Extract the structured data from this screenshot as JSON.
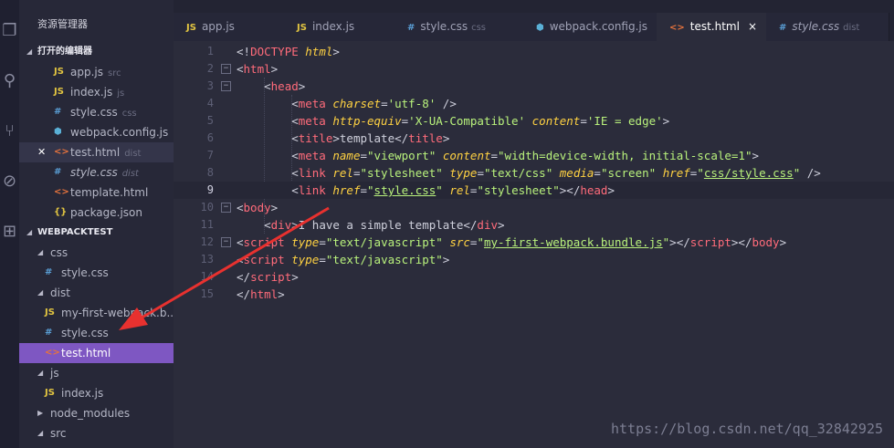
{
  "activity_bar": [
    {
      "name": "explorer-icon",
      "glyph": "❐"
    },
    {
      "name": "search-icon",
      "glyph": "⚲"
    },
    {
      "name": "source-control-icon",
      "glyph": "⑂"
    },
    {
      "name": "debug-icon",
      "glyph": "⊘"
    },
    {
      "name": "extensions-icon",
      "glyph": "⊞"
    }
  ],
  "sidebar": {
    "title": "资源管理器",
    "open_editors_label": "打开的编辑器",
    "open_editors": [
      {
        "icon": "JS",
        "icon_class": "i-js",
        "label": "app.js",
        "desc": "src"
      },
      {
        "icon": "JS",
        "icon_class": "i-js",
        "label": "index.js",
        "desc": "js"
      },
      {
        "icon": "#",
        "icon_class": "i-css",
        "label": "style.css",
        "desc": "css"
      },
      {
        "icon": "⬢",
        "icon_class": "i-cfg",
        "label": "webpack.config.js",
        "desc": ""
      },
      {
        "icon": "<>",
        "icon_class": "i-html",
        "label": "test.html",
        "desc": "dist",
        "active": true
      },
      {
        "icon": "#",
        "icon_class": "i-css",
        "label": "style.css",
        "desc": "dist",
        "italic": true
      },
      {
        "icon": "<>",
        "icon_class": "i-html",
        "label": "template.html",
        "desc": ""
      },
      {
        "icon": "{}",
        "icon_class": "i-json",
        "label": "package.json",
        "desc": ""
      }
    ],
    "project_label": "WEBPACKTEST",
    "tree": [
      {
        "type": "folder",
        "label": "css",
        "depth": 1,
        "open": true
      },
      {
        "type": "file",
        "icon": "#",
        "icon_class": "i-css",
        "label": "style.css",
        "depth": 2
      },
      {
        "type": "folder",
        "label": "dist",
        "depth": 1,
        "open": true
      },
      {
        "type": "file",
        "icon": "JS",
        "icon_class": "i-js",
        "label": "my-first-webpack.b...",
        "depth": 2
      },
      {
        "type": "file",
        "icon": "#",
        "icon_class": "i-css",
        "label": "style.css",
        "depth": 2
      },
      {
        "type": "file",
        "icon": "<>",
        "icon_class": "i-html",
        "label": "test.html",
        "depth": 2,
        "selected": true
      },
      {
        "type": "folder",
        "label": "js",
        "depth": 1,
        "open": true
      },
      {
        "type": "file",
        "icon": "JS",
        "icon_class": "i-js",
        "label": "index.js",
        "depth": 2
      },
      {
        "type": "folder",
        "label": "node_modules",
        "depth": 1,
        "open": false
      },
      {
        "type": "folder",
        "label": "src",
        "depth": 1,
        "open": true
      }
    ]
  },
  "tabs": [
    {
      "icon": "JS",
      "icon_class": "i-js",
      "label": "app.js",
      "desc": ""
    },
    {
      "icon": "JS",
      "icon_class": "i-js",
      "label": "index.js",
      "desc": ""
    },
    {
      "icon": "#",
      "icon_class": "i-css",
      "label": "style.css",
      "desc": "css"
    },
    {
      "icon": "⬢",
      "icon_class": "i-cfg",
      "label": "webpack.config.js",
      "desc": ""
    },
    {
      "icon": "<>",
      "icon_class": "i-html",
      "label": "test.html",
      "desc": "",
      "active": true,
      "close": "×"
    },
    {
      "icon": "#",
      "icon_class": "i-css",
      "label": "style.css",
      "desc": "dist",
      "italic": true
    }
  ],
  "editor": {
    "current_line": 9,
    "lines": [
      [
        [
          "p",
          "<!"
        ],
        [
          "t",
          "DOCTYPE"
        ],
        [
          "p",
          " "
        ],
        [
          "a",
          "html"
        ],
        [
          "p",
          ">"
        ]
      ],
      [
        [
          "p",
          "<"
        ],
        [
          "t",
          "html"
        ],
        [
          "p",
          ">"
        ]
      ],
      [
        [
          "p",
          "    <"
        ],
        [
          "t",
          "head"
        ],
        [
          "p",
          ">"
        ]
      ],
      [
        [
          "p",
          "        <"
        ],
        [
          "t",
          "meta"
        ],
        [
          "p",
          " "
        ],
        [
          "a",
          "charset"
        ],
        [
          "p",
          "="
        ],
        [
          "s",
          "'utf-8'"
        ],
        [
          "p",
          " />"
        ]
      ],
      [
        [
          "p",
          "        <"
        ],
        [
          "t",
          "meta"
        ],
        [
          "p",
          " "
        ],
        [
          "a",
          "http-equiv"
        ],
        [
          "p",
          "="
        ],
        [
          "s",
          "'X-UA-Compatible'"
        ],
        [
          "p",
          " "
        ],
        [
          "a",
          "content"
        ],
        [
          "p",
          "="
        ],
        [
          "s",
          "'IE = edge'"
        ],
        [
          "p",
          ">"
        ]
      ],
      [
        [
          "p",
          "        <"
        ],
        [
          "t",
          "title"
        ],
        [
          "p",
          ">template</"
        ],
        [
          "t",
          "title"
        ],
        [
          "p",
          ">"
        ]
      ],
      [
        [
          "p",
          "        <"
        ],
        [
          "t",
          "meta"
        ],
        [
          "p",
          " "
        ],
        [
          "a",
          "name"
        ],
        [
          "p",
          "="
        ],
        [
          "s",
          "\"viewport\""
        ],
        [
          "p",
          " "
        ],
        [
          "a",
          "content"
        ],
        [
          "p",
          "="
        ],
        [
          "s",
          "\"width=device-width, initial-scale=1\""
        ],
        [
          "p",
          ">"
        ]
      ],
      [
        [
          "p",
          "        <"
        ],
        [
          "t",
          "link"
        ],
        [
          "p",
          " "
        ],
        [
          "a",
          "rel"
        ],
        [
          "p",
          "="
        ],
        [
          "s",
          "\"stylesheet\""
        ],
        [
          "p",
          " "
        ],
        [
          "a",
          "type"
        ],
        [
          "p",
          "="
        ],
        [
          "s",
          "\"text/css\""
        ],
        [
          "p",
          " "
        ],
        [
          "a",
          "media"
        ],
        [
          "p",
          "="
        ],
        [
          "s",
          "\"screen\""
        ],
        [
          "p",
          " "
        ],
        [
          "a",
          "href"
        ],
        [
          "p",
          "="
        ],
        [
          "s",
          "\""
        ],
        [
          "u",
          "css/style.css"
        ],
        [
          "s",
          "\""
        ],
        [
          "p",
          " />"
        ]
      ],
      [
        [
          "p",
          "        <"
        ],
        [
          "t",
          "link"
        ],
        [
          "p",
          " "
        ],
        [
          "a",
          "href"
        ],
        [
          "p",
          "="
        ],
        [
          "s",
          "\""
        ],
        [
          "u",
          "style.css"
        ],
        [
          "s",
          "\""
        ],
        [
          "p",
          " "
        ],
        [
          "a",
          "rel"
        ],
        [
          "p",
          "="
        ],
        [
          "s",
          "\"stylesheet\""
        ],
        [
          "p",
          "></"
        ],
        [
          "t",
          "head"
        ],
        [
          "p",
          ">"
        ]
      ],
      [
        [
          "p",
          "<"
        ],
        [
          "t",
          "body"
        ],
        [
          "p",
          ">"
        ]
      ],
      [
        [
          "p",
          "    <"
        ],
        [
          "t",
          "div"
        ],
        [
          "p",
          ">I have a simple template</"
        ],
        [
          "t",
          "div"
        ],
        [
          "p",
          ">"
        ]
      ],
      [
        [
          "p",
          "<"
        ],
        [
          "t",
          "script"
        ],
        [
          "p",
          " "
        ],
        [
          "a",
          "type"
        ],
        [
          "p",
          "="
        ],
        [
          "s",
          "\"text/javascript\""
        ],
        [
          "p",
          " "
        ],
        [
          "a",
          "src"
        ],
        [
          "p",
          "="
        ],
        [
          "s",
          "\""
        ],
        [
          "u",
          "my-first-webpack.bundle.js"
        ],
        [
          "s",
          "\""
        ],
        [
          "p",
          "></"
        ],
        [
          "t",
          "script"
        ],
        [
          "p",
          "></"
        ],
        [
          "t",
          "body"
        ],
        [
          "p",
          ">"
        ]
      ],
      [
        [
          "p",
          "<"
        ],
        [
          "t",
          "script"
        ],
        [
          "p",
          " "
        ],
        [
          "a",
          "type"
        ],
        [
          "p",
          "="
        ],
        [
          "s",
          "\"text/javascript\""
        ],
        [
          "p",
          ">"
        ]
      ],
      [
        [
          "p",
          "</"
        ],
        [
          "t",
          "script"
        ],
        [
          "p",
          ">"
        ]
      ],
      [
        [
          "p",
          "</"
        ],
        [
          "t",
          "html"
        ],
        [
          "p",
          ">"
        ]
      ]
    ],
    "folds": [
      2,
      3,
      10,
      12
    ]
  },
  "watermark": "https://blog.csdn.net/qq_32842925",
  "colors": {
    "accent": "#7e57c2",
    "annotation_arrow": "#e8312f"
  }
}
